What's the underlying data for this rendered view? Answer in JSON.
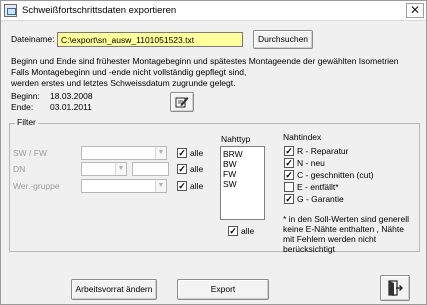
{
  "window": {
    "title": "Schweißfortschrittsdaten exportieren",
    "close_glyph": "✕"
  },
  "file": {
    "label": "Dateiname:",
    "value": "C:\\export\\sn_ausw_1101051523.txt",
    "browse_button": "Durchsuchen"
  },
  "info_text": [
    "Beginn und Ende sind frühester Montagebeginn und spätestes Montageende der gewählten Isometrien",
    "Falls Montagebeginn und -ende nicht vollständig gepflegt sind,",
    "werden erstes und letztes Schweissdatum zugrunde gelegt."
  ],
  "dates": {
    "begin_label": "Beginn:",
    "begin_value": "18.03.2008",
    "end_label": "Ende:",
    "end_value": "03.01.2011",
    "edit_icon": "edit-icon"
  },
  "filter": {
    "legend": "Filter",
    "rows": [
      {
        "label": "SW / FW",
        "all_label": "alle",
        "checked": true
      },
      {
        "label": "DN",
        "all_label": "alle",
        "checked": true
      },
      {
        "label": "Wer.-gruppe",
        "all_label": "alle",
        "checked": true
      }
    ],
    "nahttyp": {
      "label": "Nahttyp",
      "items": [
        "BRW",
        "BW",
        "FW",
        "SW"
      ],
      "all_label": "alle",
      "all_checked": true
    },
    "nahtindex": {
      "label": "Nahtindex",
      "items": [
        {
          "label": "R - Reparatur",
          "checked": true
        },
        {
          "label": "N - neu",
          "checked": true
        },
        {
          "label": "C - geschnitten (cut)",
          "checked": true
        },
        {
          "label": "E - entfällt*",
          "checked": false
        },
        {
          "label": "G - Garantie",
          "checked": true
        }
      ],
      "note": [
        "* in den Soll-Werten sind generell",
        "keine E-Nähte enthalten , Nähte",
        "mit Fehlern werden nicht",
        "berücksichtigt"
      ]
    }
  },
  "footer": {
    "workset_button": "Arbeitsvorrat ändern",
    "export_button": "Export",
    "exit_icon": "exit-door-icon"
  }
}
